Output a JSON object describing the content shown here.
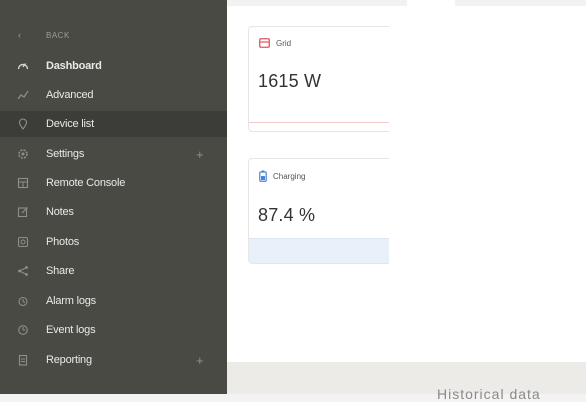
{
  "sidebar": {
    "back_label": "BACK",
    "items": [
      {
        "label": "Dashboard",
        "icon": "dashboard-gauge-icon"
      },
      {
        "label": "Advanced",
        "icon": "advanced-chart-icon"
      },
      {
        "label": "Device list",
        "icon": "device-list-pin-icon"
      },
      {
        "label": "Settings",
        "icon": "settings-gear-icon"
      },
      {
        "label": "Remote Console",
        "icon": "remote-console-icon"
      },
      {
        "label": "Notes",
        "icon": "notes-icon"
      },
      {
        "label": "Photos",
        "icon": "photos-icon"
      },
      {
        "label": "Share",
        "icon": "share-icon"
      },
      {
        "label": "Alarm logs",
        "icon": "alarm-logs-icon"
      },
      {
        "label": "Event logs",
        "icon": "event-logs-icon"
      },
      {
        "label": "Reporting",
        "icon": "reporting-icon"
      }
    ],
    "expand_symbol": "+"
  },
  "cards": {
    "grid": {
      "title": "Grid",
      "value": "1615 W",
      "icon": "grid-icon",
      "color": "#e0565b"
    },
    "charging": {
      "title": "Charging",
      "value": "87.4 %",
      "icon": "battery-icon",
      "color": "#4a86d6"
    }
  },
  "footer": {
    "cut_text": "Historical data"
  }
}
